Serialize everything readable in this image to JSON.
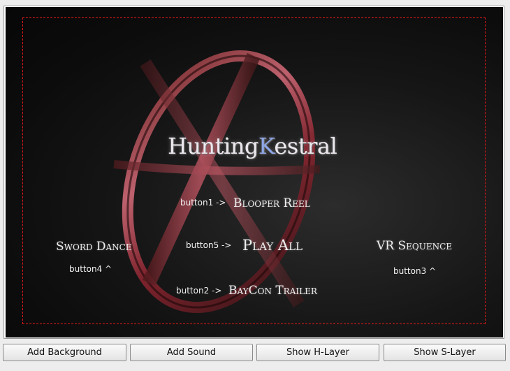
{
  "stage": {
    "title_part1": "Hunting",
    "title_part2": "K",
    "title_part3": "estral",
    "menu_items": {
      "blooper_reel": "Blooper Reel",
      "play_all": "Play All",
      "sword_dance": "Sword Dance",
      "vr_sequence": "VR Sequence",
      "baycon_trailer": "BayCon Trailer"
    },
    "button_tags": {
      "button1": "button1 ->",
      "button5": "button5 ->",
      "button2": "button2 ->",
      "button4": "button4 ^",
      "button3": "button3 ^"
    },
    "safe_area_color": "#e01818"
  },
  "toolbar": {
    "add_background": "Add Background",
    "add_sound": "Add Sound",
    "show_h_layer": "Show H-Layer",
    "show_s_layer": "Show S-Layer"
  }
}
